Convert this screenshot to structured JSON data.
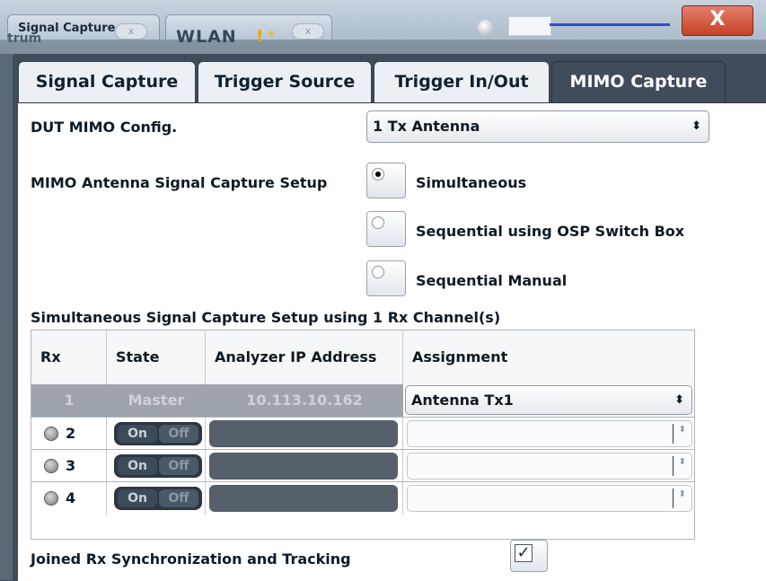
{
  "window": {
    "app_tab_1": "Signal Capture",
    "app_tab_1_under": "trum",
    "app_tab_2": "WLAN",
    "warning_symbol": "!",
    "star_symbol": "*",
    "tab_close_symbol": "x",
    "close_symbol": "X"
  },
  "tabs": [
    {
      "label": "Signal Capture",
      "active": false
    },
    {
      "label": "Trigger Source",
      "active": false
    },
    {
      "label": "Trigger In/Out",
      "active": false
    },
    {
      "label": "MIMO Capture",
      "active": true
    }
  ],
  "dut_mimo_config": {
    "label": "DUT MIMO Config.",
    "value": "1 Tx Antenna"
  },
  "capture_setup": {
    "label": "MIMO Antenna Signal Capture Setup",
    "options": [
      {
        "label": "Simultaneous",
        "selected": true
      },
      {
        "label": "Sequential using OSP Switch Box",
        "selected": false
      },
      {
        "label": "Sequential Manual",
        "selected": false
      }
    ]
  },
  "table": {
    "caption": "Simultaneous Signal Capture Setup using 1 Rx Channel(s)",
    "headers": [
      "Rx",
      "State",
      "Analyzer IP Address",
      "Assignment"
    ],
    "master_row": {
      "rx": "1",
      "state": "Master",
      "ip": "10.113.10.162",
      "assignment": "Antenna Tx1"
    },
    "rows": [
      {
        "rx": "2",
        "on": "On",
        "off": "Off"
      },
      {
        "rx": "3",
        "on": "On",
        "off": "Off"
      },
      {
        "rx": "4",
        "on": "On",
        "off": "Off"
      }
    ]
  },
  "joined_sync": {
    "label": "Joined Rx Synchronization and Tracking",
    "checked": true
  },
  "colors": {
    "active_tab": "#404c5a",
    "close_button": "#c74226",
    "slider_line": "#2b4fd4"
  }
}
